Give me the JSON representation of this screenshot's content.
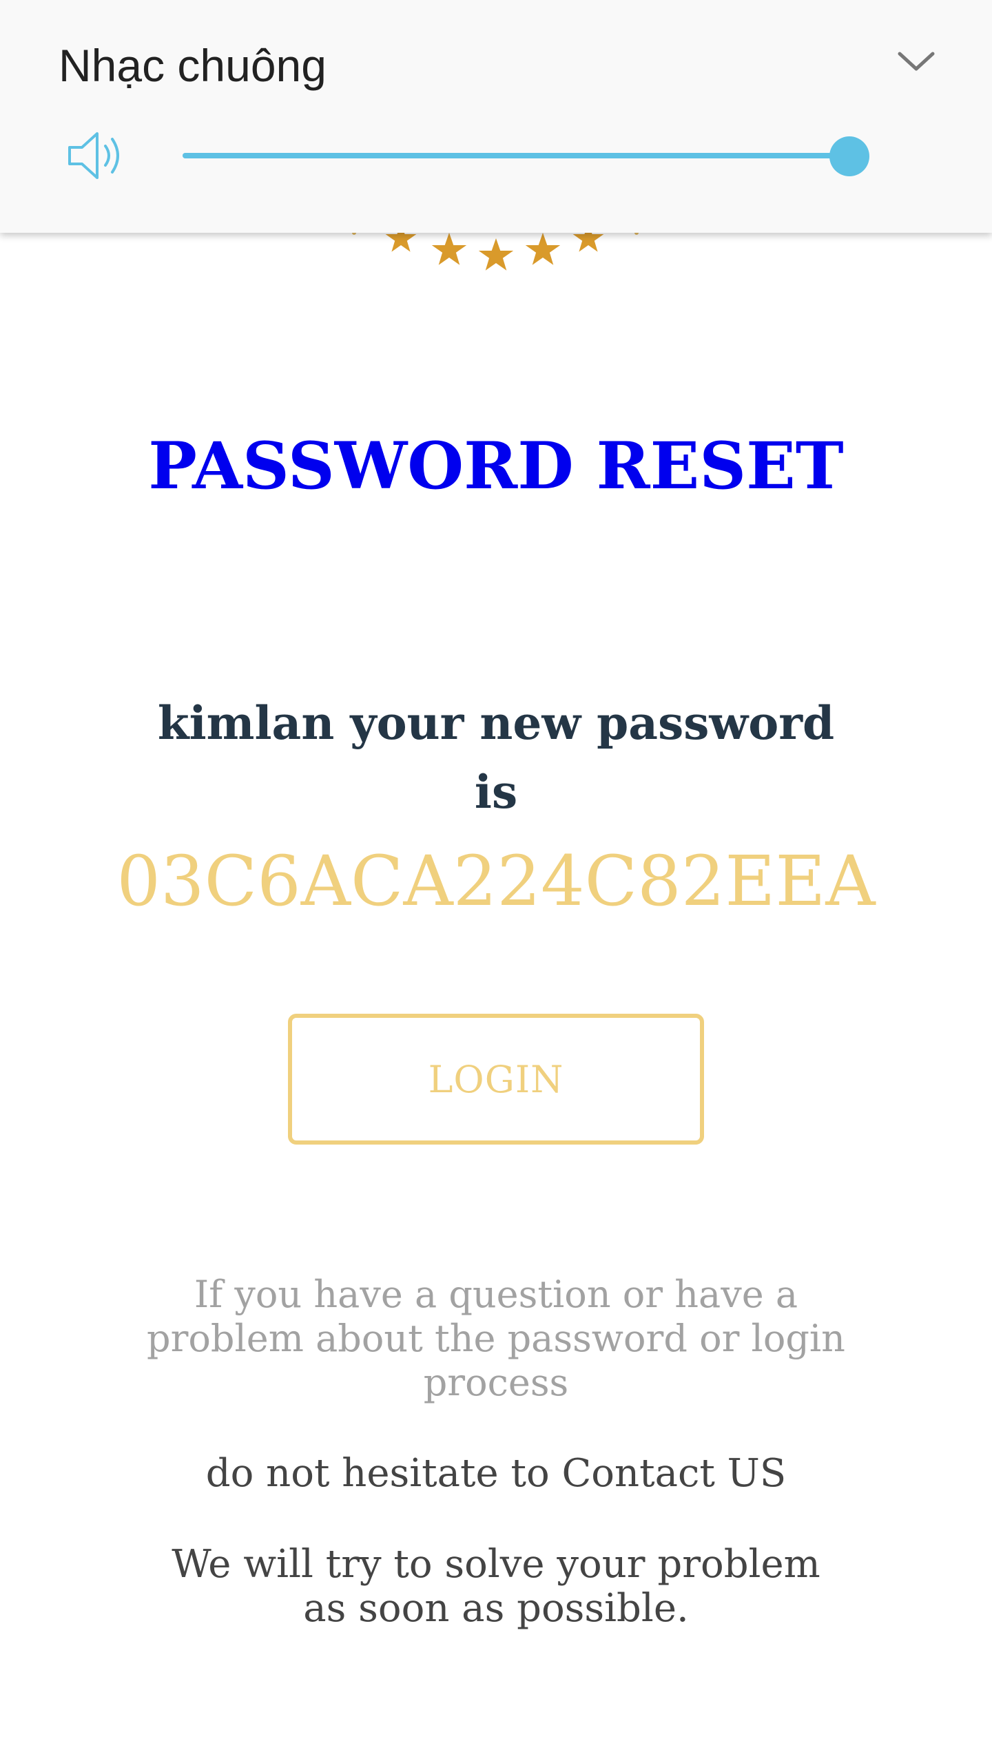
{
  "volume_panel": {
    "title": "Nhạc chuông",
    "level": 1.0,
    "accent_color": "#5ec1e4",
    "icons": {
      "speaker": "speaker-volume-icon",
      "collapse": "chevron-down-icon"
    }
  },
  "logo": {
    "icon": "stars-logo-icon",
    "star_color": "#d99a2b"
  },
  "page": {
    "title": "PASSWORD RESET",
    "title_color": "#0000ee",
    "message": "kimlan your new password is",
    "password": "03C6ACA224C82EEA",
    "accent_color": "#f0d07e",
    "login_label": "LOGIN",
    "help_text": "If you have a question or have a problem about the password or login process",
    "contact_text": "do not hesitate to Contact US",
    "solve_text": "We will try to solve your problem as soon as possible."
  }
}
